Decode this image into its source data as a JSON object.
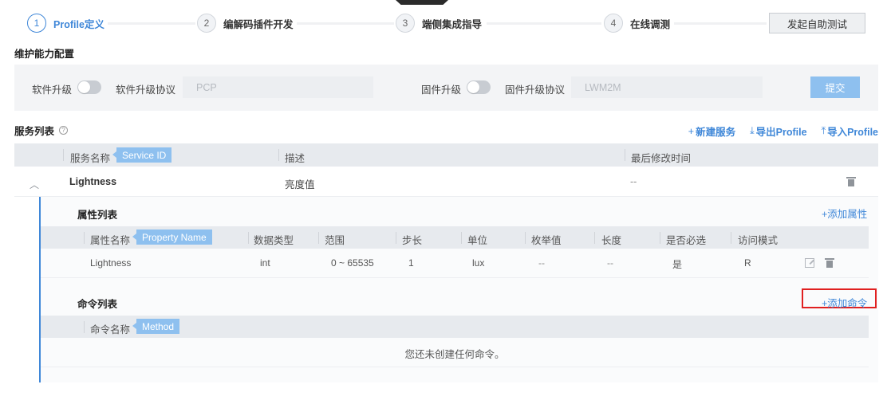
{
  "stepper": {
    "steps": [
      {
        "num": "1",
        "label": "Profile定义"
      },
      {
        "num": "2",
        "label": "编解码插件开发"
      },
      {
        "num": "3",
        "label": "端侧集成指导"
      },
      {
        "num": "4",
        "label": "在线调测"
      }
    ],
    "start_test": "发起自助测试"
  },
  "maintenance": {
    "title": "维护能力配置",
    "software_upgrade_label": "软件升级",
    "software_protocol_label": "软件升级协议",
    "software_protocol_value": "PCP",
    "firmware_upgrade_label": "固件升级",
    "firmware_protocol_label": "固件升级协议",
    "firmware_protocol_value": "LWM2M",
    "submit": "提交"
  },
  "services": {
    "title": "服务列表",
    "help": "?",
    "actions": {
      "new_service": "新建服务",
      "export": "导出Profile",
      "import": "导入Profile"
    },
    "columns": {
      "name": "服务名称",
      "name_tag": "Service ID",
      "desc": "描述",
      "modified": "最后修改时间"
    },
    "row": {
      "name": "Lightness",
      "desc": "亮度值",
      "modified": "--"
    }
  },
  "properties": {
    "title": "属性列表",
    "add": "+添加属性",
    "columns": {
      "name": "属性名称",
      "name_tag": "Property Name",
      "type": "数据类型",
      "range": "范围",
      "step": "步长",
      "unit": "单位",
      "enum": "枚举值",
      "length": "长度",
      "required": "是否必选",
      "access": "访问模式"
    },
    "row": {
      "name": "Lightness",
      "type": "int",
      "range": "0 ~ 65535",
      "step": "1",
      "unit": "lux",
      "enum": "--",
      "length": "--",
      "required": "是",
      "access": "R"
    }
  },
  "commands": {
    "title": "命令列表",
    "add": "+添加命令",
    "columns": {
      "name": "命令名称",
      "name_tag": "Method"
    },
    "empty": "您还未创建任何命令。"
  }
}
